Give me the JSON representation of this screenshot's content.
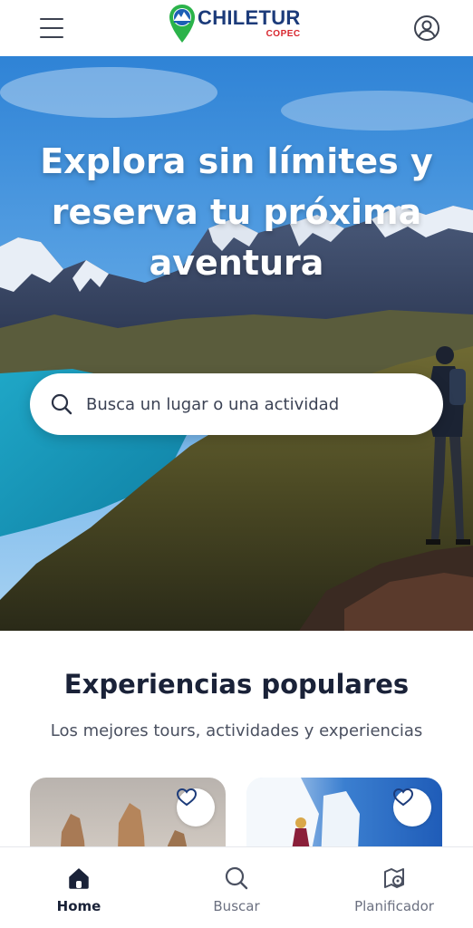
{
  "header": {
    "logo_main": "CHILETUR",
    "logo_sub": "COPEC"
  },
  "hero": {
    "title": "Explora sin límites y reserva tu próxima aventura"
  },
  "search": {
    "placeholder": "Busca un lugar o una actividad"
  },
  "section": {
    "title": "Experiencias populares",
    "subtitle": "Los mejores tours, actividades y experiencias"
  },
  "bottom_nav": {
    "items": [
      {
        "label": "Home",
        "icon": "home-icon",
        "active": true
      },
      {
        "label": "Buscar",
        "icon": "search-icon",
        "active": false
      },
      {
        "label": "Planificador",
        "icon": "planner-icon",
        "active": false
      }
    ]
  },
  "colors": {
    "brand_blue": "#1c3b7a",
    "brand_red": "#d8262e",
    "logo_green": "#2bb34a",
    "text_dark": "#1a2238"
  }
}
